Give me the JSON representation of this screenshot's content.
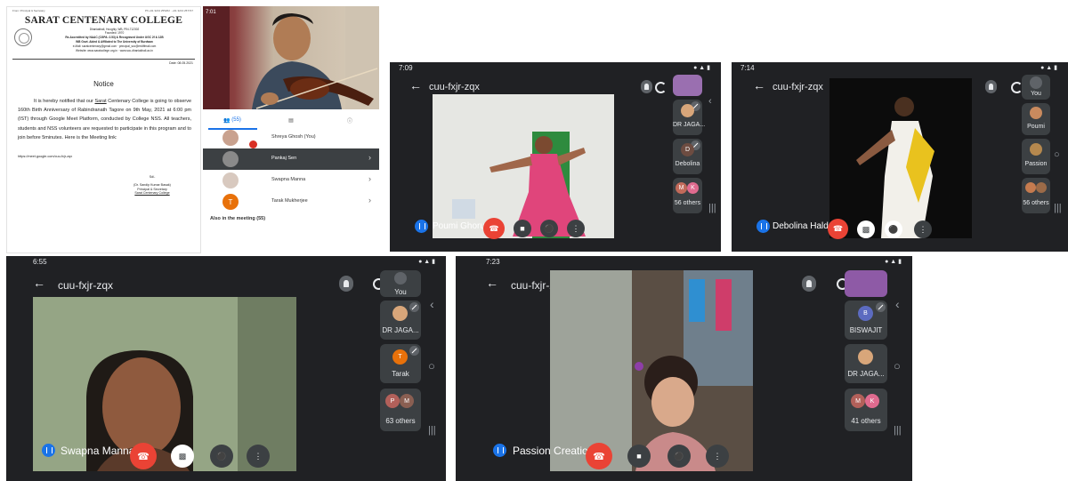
{
  "notice": {
    "top_left": "From: Principal & Secretary",
    "top_right": "Ph:+91 3213 255262 · +91 3213 257747",
    "college_name": "SARAT CENTENARY COLLEGE",
    "address": "Dhaniakhali, Hooghly, WB, PIN-712302",
    "founded": "Founded: 1970",
    "accreditation": "Re-Accredited by NAAC (CGPA: 2.53) & Recognised Under UGC 2f & 12B",
    "affiliation": "WB Govt. Aided & Affiliated to The University of Burdwan",
    "email": "e-Mail: saratcentenary@gmail.com · principal_scc@rediffmail.com",
    "website": "Website: www.saratcollege.org.in · www.scc-dhaniakhali.ac.in",
    "date": "Date: 08.05.2021",
    "heading": "Notice",
    "body_1": "It is hereby notified that our",
    "body_underlined": "Sarat",
    "body_2": "Centenary College is going to observe 160th Birth Anniversary of Rabindranath Tagore on 9th May, 2021 at 6:00 pm (IST) through Google Meet Platform, conducted by College NSS. All teachers, students and NSS volunteers are requested to participate in this program and to join before 5minutes. Here is the Meeting link:",
    "link": "https://meet.google.com/cuu-fxjr-zqx",
    "sd": "Sd/-",
    "signatory": "(Dr. Sandip Kumar Basak)",
    "sig_title": "Principal & Secretary",
    "sig_org": "Sarat Centenary College"
  },
  "participants_panel": {
    "status": "7:01",
    "tab_people_count": "(55)",
    "people": [
      {
        "name": "Shreya Ghosh (You)"
      },
      {
        "name": "Pankaj Sen"
      },
      {
        "name": "Swapna Manna"
      },
      {
        "name": "Tarak Mukherjee"
      }
    ],
    "tarak_initial": "T",
    "also_in_meeting": "Also in the meeting (55)"
  },
  "meet_a": {
    "time": "7:09",
    "meeting_code": "cuu-fxjr-zqx",
    "speaker": "Poumi Ghorui",
    "tiles": [
      {
        "label": "DR JAGA...",
        "initial": ""
      },
      {
        "label": "Debolina",
        "initial": "D"
      },
      {
        "label": "56 others",
        "initial": "M"
      }
    ],
    "others_initial_2": "K"
  },
  "meet_b": {
    "time": "7:14",
    "meeting_code": "cuu-fxjr-zqx",
    "speaker": "Debolina Halder",
    "tiles": [
      {
        "label": "You"
      },
      {
        "label": "Poumi"
      },
      {
        "label": "Passion"
      },
      {
        "label": "56 others"
      }
    ]
  },
  "meet_c": {
    "time": "6:55",
    "meeting_code": "cuu-fxjr-zqx",
    "speaker": "Swapna Manna",
    "tiles": [
      {
        "label": "You"
      },
      {
        "label": "DR JAGA..."
      },
      {
        "label": "Tarak",
        "initial": "T"
      },
      {
        "label": "63 others",
        "initial": "P"
      }
    ],
    "others_initial_2": "M"
  },
  "meet_d": {
    "time": "7:23",
    "meeting_code": "cuu-fxjr-zqx",
    "speaker": "Passion Creation",
    "tiles": [
      {
        "label": ""
      },
      {
        "label": "BISWAJIT",
        "initial": "B"
      },
      {
        "label": "DR JAGA..."
      },
      {
        "label": "41 others",
        "initial": "M"
      }
    ],
    "others_initial_2": "K"
  },
  "colors": {
    "meet_bg": "#202124",
    "end_call": "#ea4335",
    "accent_blue": "#1a73e8"
  }
}
